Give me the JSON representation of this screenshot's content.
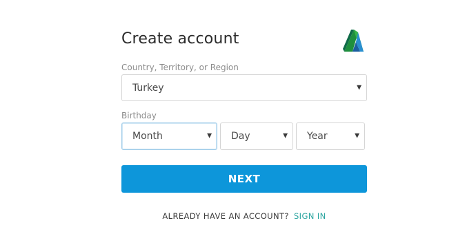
{
  "header": {
    "title": "Create account",
    "logo_icon": "autodesk-logo-icon"
  },
  "country": {
    "label": "Country, Territory, or Region",
    "selected": "Turkey"
  },
  "birthday": {
    "label": "Birthday",
    "month": "Month",
    "day": "Day",
    "year": "Year"
  },
  "actions": {
    "next_label": "NEXT"
  },
  "footer": {
    "prompt": "ALREADY HAVE AN ACCOUNT?",
    "signin_label": "SIGN IN"
  },
  "colors": {
    "primary_button": "#0d96da",
    "link": "#2ba5a0",
    "focus_border": "#9ecbe8"
  },
  "icons": {
    "dropdown": "caret-down-icon"
  }
}
